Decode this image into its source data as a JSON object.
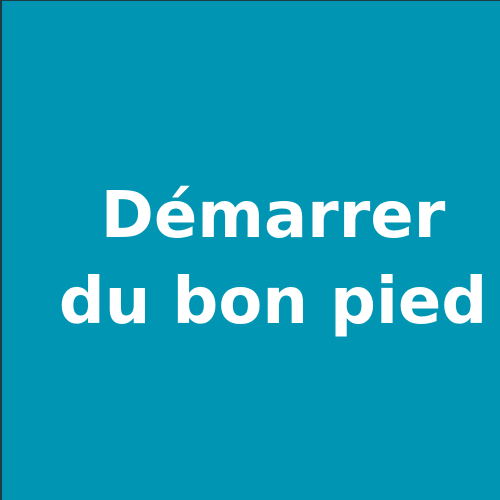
{
  "tile": {
    "background_color": "#0096B3",
    "text_color": "#FFFFFF",
    "line1": "Démarrer",
    "line2": "du bon pied"
  }
}
